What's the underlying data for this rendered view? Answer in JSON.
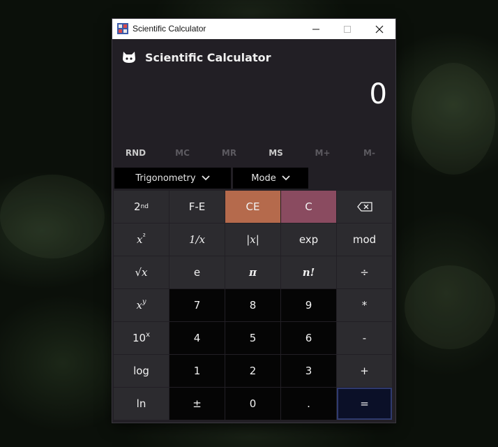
{
  "window": {
    "title": "Scientific Calculator",
    "controls": {
      "minimize": "minimize-icon",
      "maximize": "maximize-icon",
      "close": "close-icon"
    }
  },
  "header": {
    "title": "Scientific Calculator",
    "icon": "cat-icon"
  },
  "display": {
    "value": "0"
  },
  "memory": {
    "buttons": [
      {
        "label": "RND",
        "enabled": true
      },
      {
        "label": "MC",
        "enabled": false
      },
      {
        "label": "MR",
        "enabled": false
      },
      {
        "label": "MS",
        "enabled": true
      },
      {
        "label": "M+",
        "enabled": false
      },
      {
        "label": "M-",
        "enabled": false
      }
    ]
  },
  "dropdowns": {
    "trig": "Trigonometry",
    "mode": "Mode"
  },
  "keys": {
    "second": {
      "base": "2",
      "sup": "nd"
    },
    "fe": "F-E",
    "ce": "CE",
    "c": "C",
    "square": {
      "base": "x",
      "sup": "²"
    },
    "reciprocal": "1/x",
    "abs": "|x|",
    "exp": "exp",
    "mod": "mod",
    "sqrt": "√x",
    "e": "e",
    "pi": "π",
    "factorial": "n!",
    "divide": "÷",
    "power": {
      "base": "x",
      "sup": "y"
    },
    "n7": "7",
    "n8": "8",
    "n9": "9",
    "multiply": "*",
    "ten_power": {
      "base": "10",
      "sup": "x"
    },
    "n4": "4",
    "n5": "5",
    "n6": "6",
    "minus": "-",
    "log": "log",
    "n1": "1",
    "n2": "2",
    "n3": "3",
    "plus": "+",
    "ln": "ln",
    "negate": "±",
    "n0": "0",
    "decimal": ".",
    "equals": "="
  },
  "colors": {
    "ce": "#b56a4c",
    "c": "#8a4b60",
    "equals_border": "#2f3a6e",
    "window_bg": "#221f25"
  }
}
